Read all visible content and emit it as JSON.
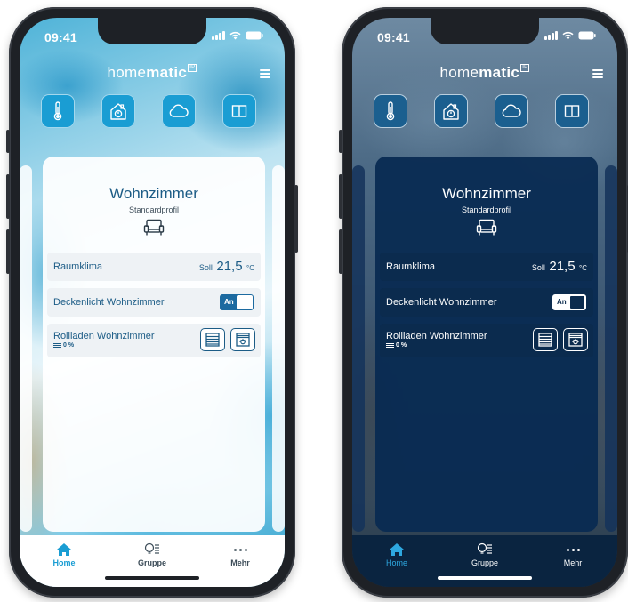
{
  "status": {
    "time": "09:41"
  },
  "brand": {
    "part1": "home",
    "part2": "matic",
    "badge": "IP"
  },
  "categories": [
    {
      "icon": "thermometer-icon"
    },
    {
      "icon": "house-icon"
    },
    {
      "icon": "cloud-icon"
    },
    {
      "icon": "window-icon"
    }
  ],
  "room": {
    "title": "Wohnzimmer",
    "profile": "Standardprofil",
    "icon": "sofa-icon"
  },
  "rows": {
    "climate": {
      "label": "Raumklima",
      "soll_label": "Soll",
      "value": "21,5",
      "unit": "°C"
    },
    "light": {
      "label": "Deckenlicht Wohnzimmer",
      "toggle_text": "An"
    },
    "shutter": {
      "label": "Rollladen Wohnzimmer",
      "percent": "0 %"
    }
  },
  "tabs": {
    "home": "Home",
    "gruppe": "Gruppe",
    "mehr": "Mehr"
  },
  "colors": {
    "accent": "#1a9dd3",
    "light_text": "#1c5c86",
    "dark_card": "#082a52"
  }
}
